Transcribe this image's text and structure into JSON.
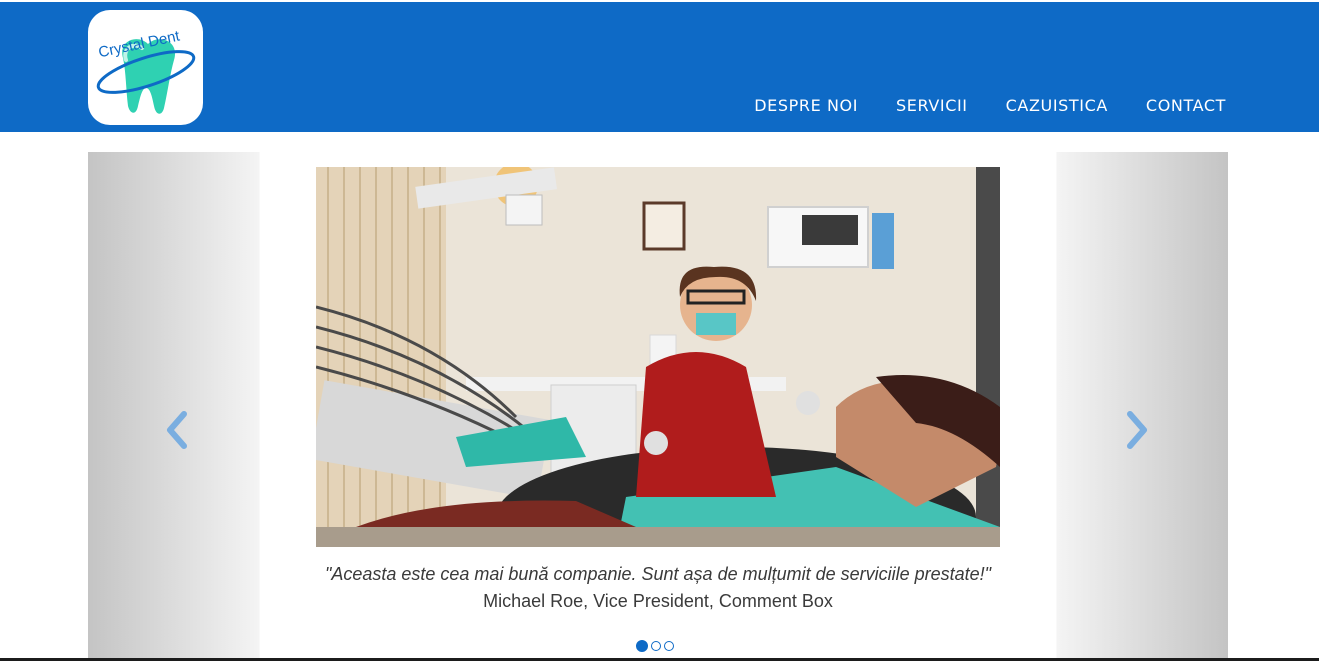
{
  "brand": {
    "logo_text": "Crystal Dent",
    "primary_color": "#0e6ac6",
    "tooth_color": "#2fd1b2"
  },
  "nav": {
    "items": [
      {
        "label": "DESPRE NOI"
      },
      {
        "label": "SERVICII"
      },
      {
        "label": "CAZUISTICA"
      },
      {
        "label": "CONTACT"
      }
    ]
  },
  "carousel": {
    "icons": {
      "prev": "chevron-left-icon",
      "next": "chevron-right-icon"
    },
    "quote": "\"Aceasta este cea mai bună companie. Sunt așa de mulțumit de serviciile prestate!\"",
    "author": "Michael Roe, Vice President, Comment Box",
    "slide_count": 3,
    "active_slide": 1
  }
}
